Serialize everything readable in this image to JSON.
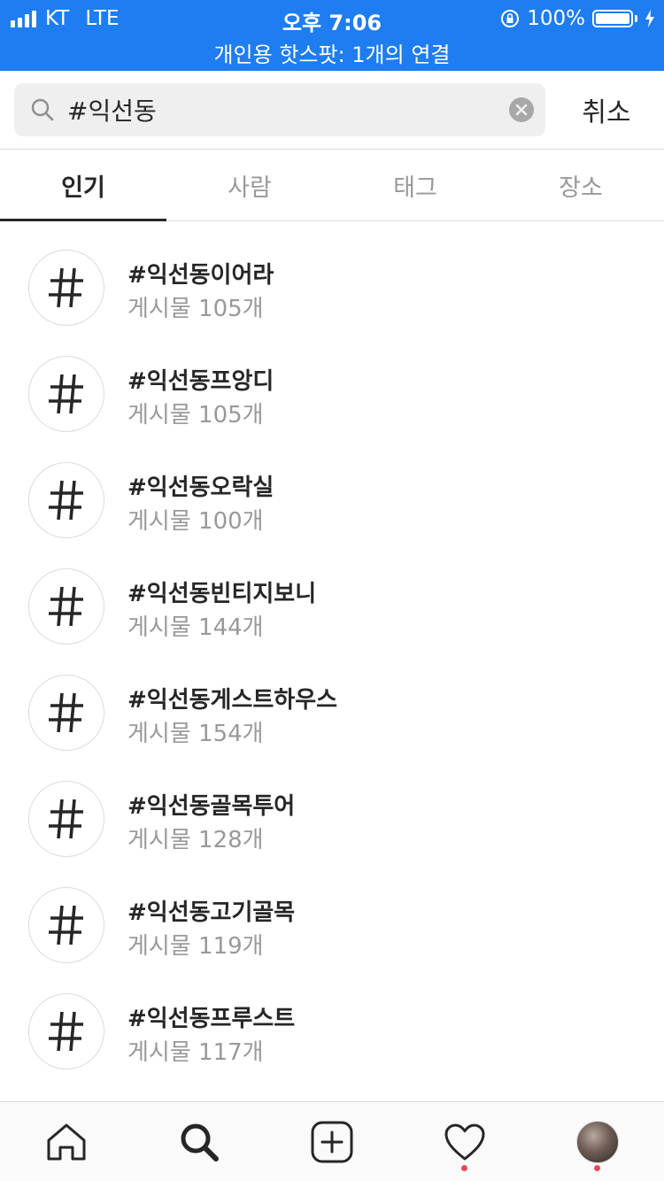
{
  "status_bar": {
    "carrier": "KT",
    "network": "LTE",
    "time": "오후 7:06",
    "battery": "100%",
    "hotspot": "개인용 핫스팟: 1개의 연결",
    "bar_color": "#1e7df0"
  },
  "search": {
    "query": "#익선동",
    "cancel_label": "취소"
  },
  "tabs": [
    {
      "label": "인기",
      "active": true
    },
    {
      "label": "사람",
      "active": false
    },
    {
      "label": "태그",
      "active": false
    },
    {
      "label": "장소",
      "active": false
    }
  ],
  "results": [
    {
      "tag": "#익선동이어라",
      "count": "게시물 105개"
    },
    {
      "tag": "#익선동프앙디",
      "count": "게시물 105개"
    },
    {
      "tag": "#익선동오락실",
      "count": "게시물 100개"
    },
    {
      "tag": "#익선동빈티지보니",
      "count": "게시물 144개"
    },
    {
      "tag": "#익선동게스트하우스",
      "count": "게시물 154개"
    },
    {
      "tag": "#익선동골목투어",
      "count": "게시물 128개"
    },
    {
      "tag": "#익선동고기골목",
      "count": "게시물 119개"
    },
    {
      "tag": "#익선동프루스트",
      "count": "게시물 117개"
    }
  ],
  "bottom_nav": {
    "items": [
      "home-icon",
      "search-icon",
      "add-post-icon",
      "heart-icon",
      "profile-avatar"
    ],
    "notification_color": "#ed4956"
  }
}
